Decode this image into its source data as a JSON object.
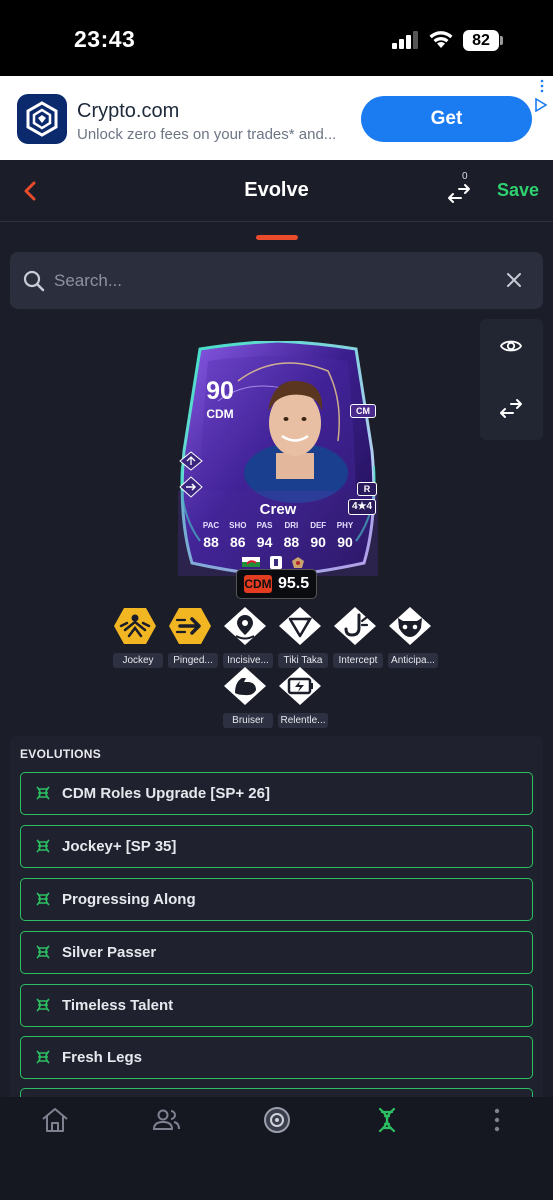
{
  "status_bar": {
    "time": "23:43",
    "battery": "82"
  },
  "ad": {
    "brand": "Crypto.com",
    "tagline": "Unlock zero fees on your trades* and...",
    "cta": "Get"
  },
  "header": {
    "title": "Evolve",
    "compare_count": "0",
    "save_label": "Save"
  },
  "search": {
    "placeholder": "Search..."
  },
  "card": {
    "rating": "90",
    "position": "CDM",
    "alt_position": "CM",
    "foot": "R",
    "skill_weak": "4★4",
    "name": "Crew",
    "stats": [
      {
        "label": "PAC",
        "value": "88"
      },
      {
        "label": "SHO",
        "value": "86"
      },
      {
        "label": "PAS",
        "value": "94"
      },
      {
        "label": "DRI",
        "value": "88"
      },
      {
        "label": "DEF",
        "value": "90"
      },
      {
        "label": "PHY",
        "value": "90"
      }
    ]
  },
  "role_rating": {
    "position": "CDM",
    "value": "95.5"
  },
  "playstyles": [
    {
      "name": "Jockey",
      "plus": true
    },
    {
      "name": "Pinged...",
      "plus": true
    },
    {
      "name": "Incisive...",
      "plus": false
    },
    {
      "name": "Tiki Taka",
      "plus": false
    },
    {
      "name": "Intercept",
      "plus": false
    },
    {
      "name": "Anticipa...",
      "plus": false
    },
    {
      "name": "Bruiser",
      "plus": false
    },
    {
      "name": "Relentle...",
      "plus": false
    }
  ],
  "evolutions": {
    "heading": "EVOLUTIONS",
    "items": [
      "CDM Roles Upgrade [SP+ 26]",
      "Jockey+ [SP 35]",
      "Progressing Along",
      "Silver Passer",
      "Timeless Talent",
      "Fresh Legs"
    ]
  },
  "colors": {
    "accent_green": "#2bbf61",
    "accent_orange": "#ea4b2a",
    "gold": "#f2b623"
  }
}
